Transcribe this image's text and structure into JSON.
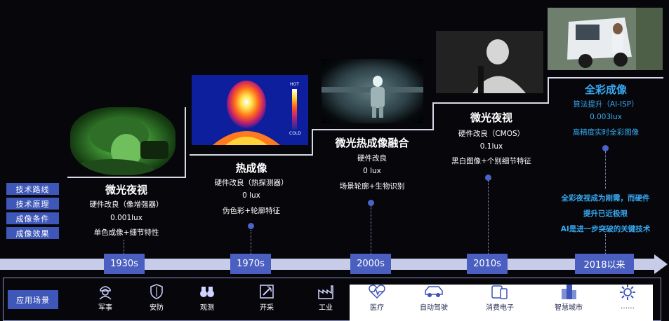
{
  "legend": [
    "技术路线",
    "技术原理",
    "成像条件",
    "成像效果"
  ],
  "stages": [
    {
      "title": "微光夜视",
      "principle": "硬件改良（像增强器）",
      "condition": "0.001lux",
      "effect": "单色成像+细节特性"
    },
    {
      "title": "热成像",
      "principle": "硬件改良（热探测器）",
      "condition": "0 lux",
      "effect": "伪色彩+轮廓特征"
    },
    {
      "title": "微光热成像融合",
      "principle": "硬件改良",
      "condition": "0 lux",
      "effect": "场景轮廓+生物识别"
    },
    {
      "title": "微光夜视",
      "principle": "硬件改良（CMOS）",
      "condition": "0.1lux",
      "effect": "黑白图像+个别细节特征"
    },
    {
      "title": "全彩成像",
      "principle": "算法提升（AI-ISP）",
      "condition": "0.003lux",
      "effect": "高精度实时全彩图像"
    }
  ],
  "note": [
    "全彩夜视成为刚需，而硬件",
    "提升已近极限",
    "AI是进一步突破的关键技术"
  ],
  "thermal_scale": {
    "hot": "HOT",
    "cold": "COLD"
  },
  "years": [
    "1930s",
    "1970s",
    "2000s",
    "2010s",
    "2018以来"
  ],
  "app_label": "应用场景",
  "apps": [
    {
      "label": "军事",
      "icon": "soldier-icon"
    },
    {
      "label": "安防",
      "icon": "shield-icon"
    },
    {
      "label": "观测",
      "icon": "binoculars-icon"
    },
    {
      "label": "开采",
      "icon": "mining-icon"
    },
    {
      "label": "工业",
      "icon": "factory-icon"
    },
    {
      "label": "医疗",
      "icon": "heartbeat-icon"
    },
    {
      "label": "自动驾驶",
      "icon": "car-icon"
    },
    {
      "label": "消费电子",
      "icon": "devices-icon"
    },
    {
      "label": "智慧城市",
      "icon": "city-icon"
    },
    {
      "label": "……",
      "icon": "gear-icon"
    }
  ],
  "colors": {
    "accent_blue": "#3f57b8",
    "highlight_text": "#36a8f0",
    "timeline": "#c7cde9"
  }
}
